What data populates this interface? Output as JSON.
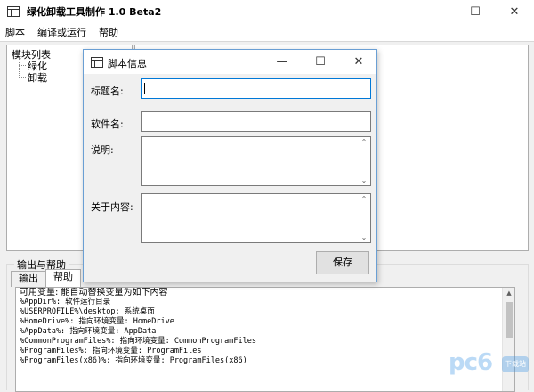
{
  "window": {
    "title": "绿化卸载工具制作 1.0 Beta2",
    "controls": {
      "minimize": "—",
      "maximize": "☐",
      "close": "✕"
    }
  },
  "menu": [
    "脚本",
    "编译或运行",
    "帮助"
  ],
  "tree": {
    "root": "模块列表",
    "children": [
      "绿化",
      "卸载"
    ]
  },
  "output_group": {
    "label": "输出与帮助",
    "tabs": [
      "输出",
      "帮助"
    ],
    "active_tab": "帮助",
    "lines": [
      "可用变量: 能自动替换变量为如下内容",
      "%AppDir%: 软件运行目录",
      "%USERPROFILE%\\desktop: 系统桌面",
      "%HomeDrive%: 指向环境变量: HomeDrive",
      "%AppData%: 指向环境变量: AppData",
      "%CommonProgramFiles%: 指向环境变量: CommonProgramFiles",
      "%ProgramFiles%: 指向环境变量: ProgramFiles",
      "%ProgramFiles(x86)%: 指向环境变量: ProgramFiles(x86)"
    ]
  },
  "dialog": {
    "title": "脚本信息",
    "controls": {
      "minimize": "—",
      "maximize": "☐",
      "close": "✕"
    },
    "fields": {
      "title_label": "标题名:",
      "title_value": "",
      "software_label": "软件名:",
      "software_value": "",
      "desc_label": "说明:",
      "about_label": "关于内容:"
    },
    "save_label": "保存"
  },
  "watermark": {
    "text": "pc6",
    "badge": "下载站"
  },
  "colors": {
    "focus_border": "#0078d7",
    "dialog_border": "#6a9fd4"
  }
}
